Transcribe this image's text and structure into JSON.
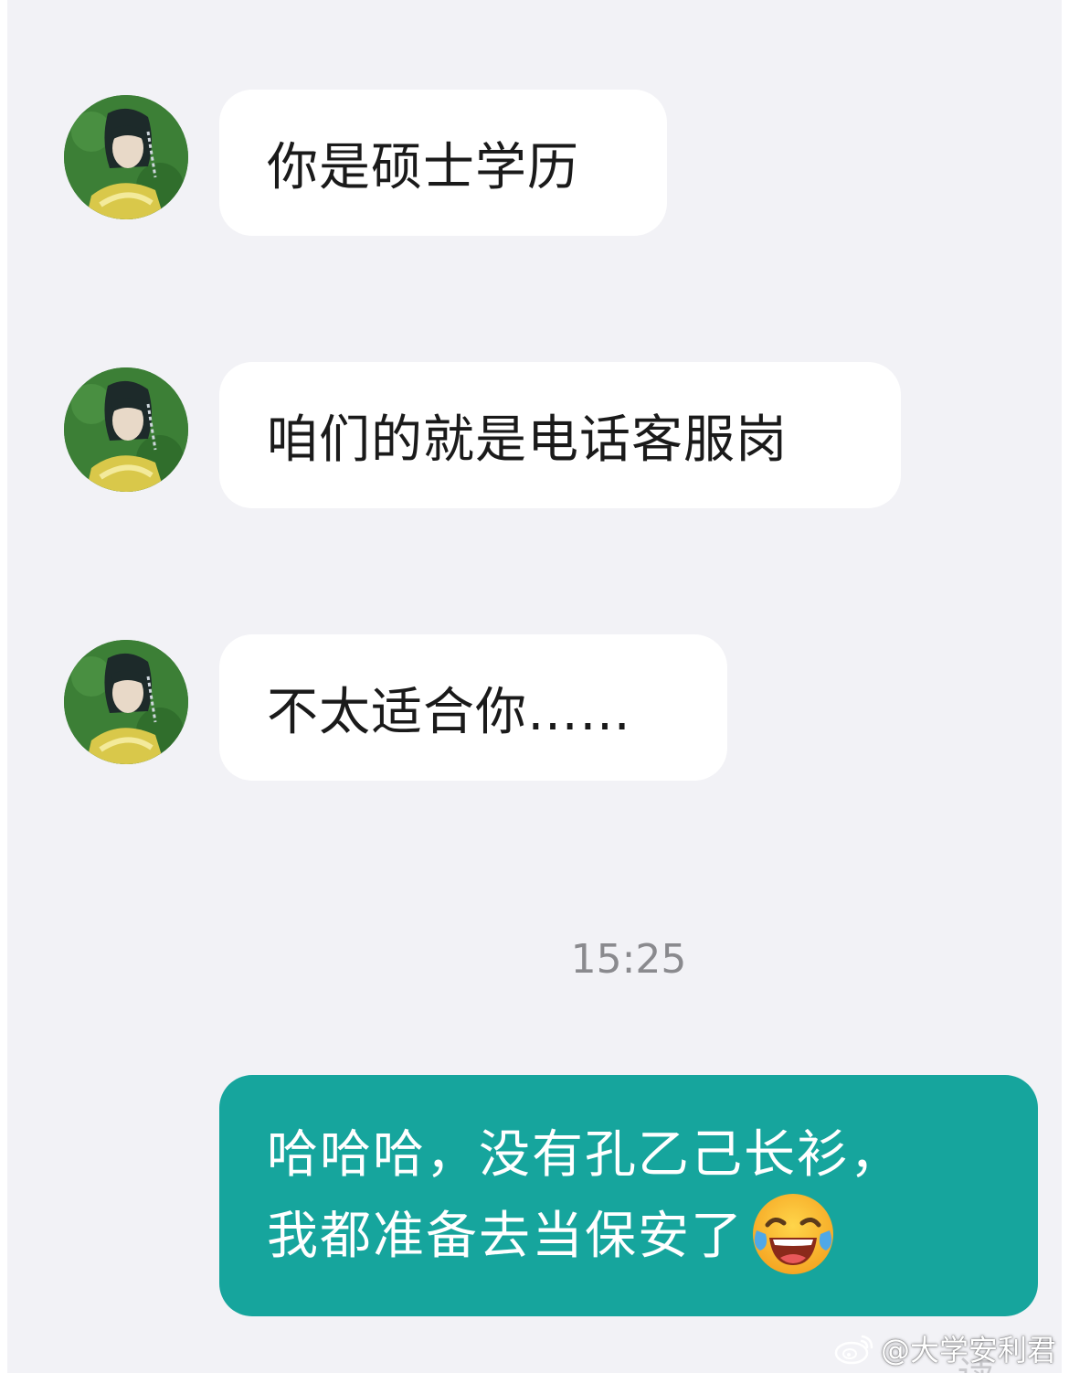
{
  "messages": [
    {
      "text": "你是硕士学历"
    },
    {
      "text": "咱们的就是电话客服岗"
    },
    {
      "text": "不太适合你……"
    }
  ],
  "timestamp": "15:25",
  "sent_message": {
    "line1": "哈哈哈，没有孔乙己长衫，",
    "line2": "我都准备去当保安了"
  },
  "status_text": "读",
  "watermark": "@大学安利君",
  "icons": {
    "avatar": "avatar",
    "emoji": "tears-of-joy-emoji",
    "watermark_logo": "weibo-icon"
  },
  "colors": {
    "background": "#f2f2f6",
    "received_bubble": "#ffffff",
    "sent_bubble": "#16a59d",
    "timestamp": "#8a8a8e"
  }
}
